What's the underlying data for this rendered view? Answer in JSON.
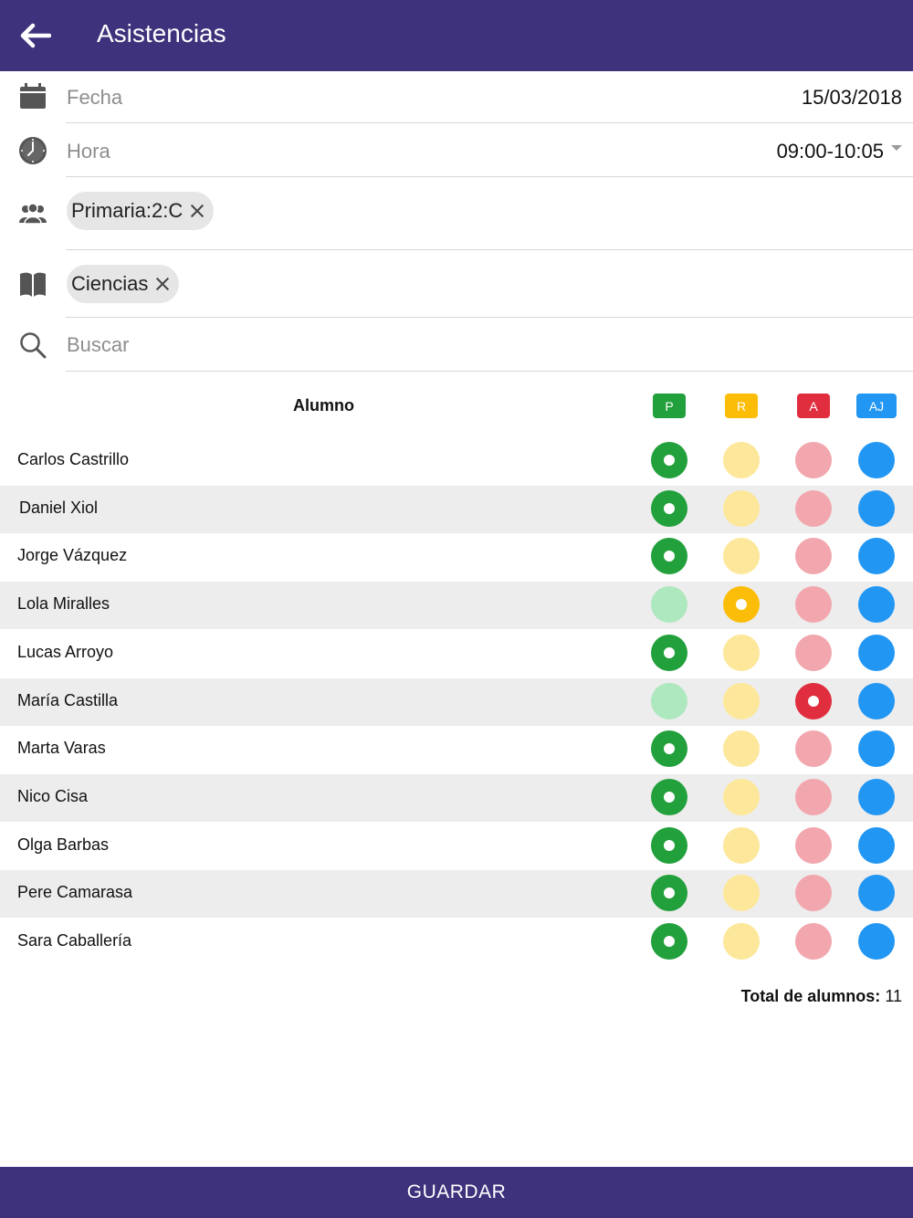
{
  "header": {
    "title": "Asistencias",
    "back_icon": "arrow-left-icon"
  },
  "form": {
    "fecha": {
      "label": "Fecha",
      "value": "15/03/2018",
      "icon": "calendar-icon"
    },
    "hora": {
      "label": "Hora",
      "value": "09:00-10:05",
      "icon": "clock-icon"
    },
    "grupo": {
      "chip": "Primaria:2:C",
      "icon": "group-icon"
    },
    "asignatura": {
      "chip": "Ciencias",
      "icon": "book-icon"
    },
    "search": {
      "placeholder": "Buscar",
      "value": "",
      "icon": "search-icon"
    }
  },
  "table": {
    "column_alumno": "Alumno",
    "legend": [
      {
        "key": "P",
        "label": "P",
        "color": "#22a03c",
        "light": "#aee8bf"
      },
      {
        "key": "R",
        "label": "R",
        "color": "#fbbd08",
        "light": "#fde79a"
      },
      {
        "key": "A",
        "label": "A",
        "color": "#e02e3f",
        "light": "#f2a7ae"
      },
      {
        "key": "AJ",
        "label": "AJ",
        "color": "#2196f3",
        "light": "#2196f3"
      }
    ],
    "students": [
      {
        "name": "Carlos Castrillo",
        "status": "P"
      },
      {
        "name": "Daniel Xiol",
        "status": "P"
      },
      {
        "name": "Jorge Vázquez",
        "status": "P"
      },
      {
        "name": "Lola Miralles",
        "status": "R"
      },
      {
        "name": "Lucas Arroyo",
        "status": "P"
      },
      {
        "name": "María Castilla",
        "status": "A"
      },
      {
        "name": "Marta Varas",
        "status": "P"
      },
      {
        "name": "Nico Cisa",
        "status": "P"
      },
      {
        "name": "Olga Barbas",
        "status": "P"
      },
      {
        "name": "Pere Camarasa",
        "status": "P"
      },
      {
        "name": "Sara Caballería",
        "status": "P"
      }
    ]
  },
  "total": {
    "label": "Total de alumnos:",
    "value": "11"
  },
  "footer": {
    "save_label": "GUARDAR"
  }
}
